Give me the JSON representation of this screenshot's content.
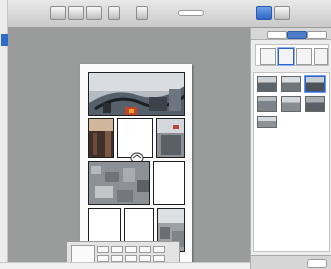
{
  "toolbar": {
    "buttons": 6
  },
  "page": {
    "caption": "",
    "caption2": ""
  },
  "colors": {
    "accent": "#2b6dc9",
    "workspace": "#9a9c9c",
    "toolbar": "#d8d8d8"
  },
  "icons": {
    "zoom": "magnifier-icon",
    "handle": "rotate-handle-icon"
  }
}
